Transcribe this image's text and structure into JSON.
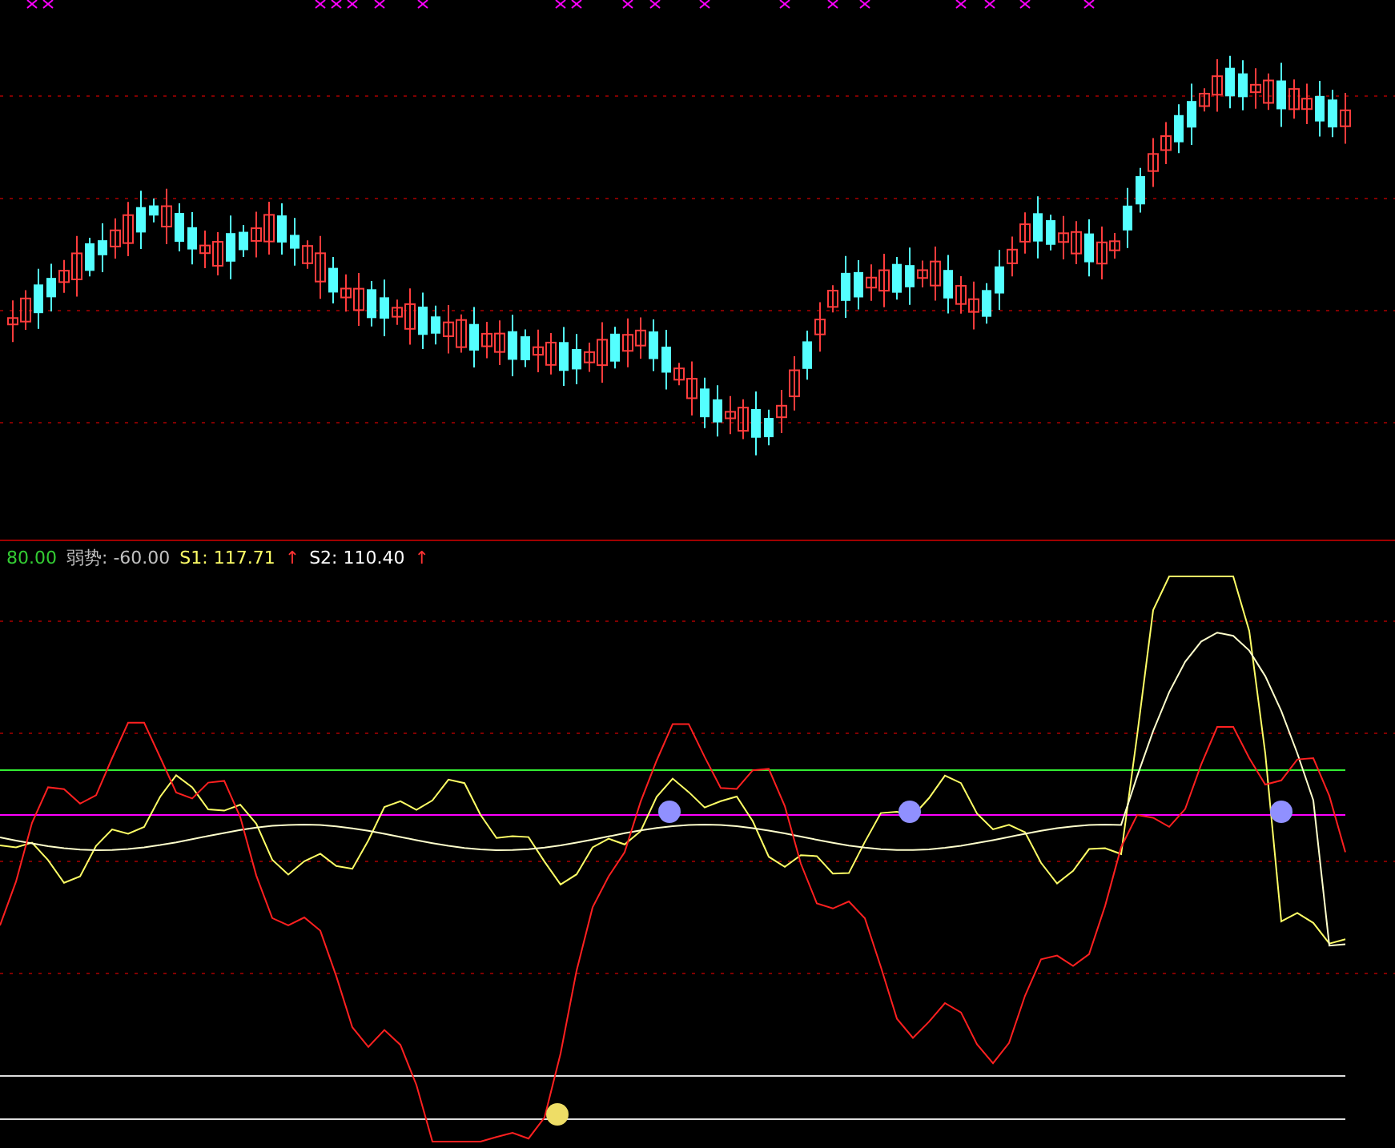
{
  "indicator_legend": [
    {
      "text": "80.00",
      "color": "#33cc33"
    },
    {
      "text": "弱势: -60.00",
      "color": "#c0c0c0"
    },
    {
      "text": "S1: 117.71",
      "color": "#ffff66"
    },
    {
      "text": "↑",
      "color": "#ff3333"
    },
    {
      "text": "S2: 110.40",
      "color": "#ffffff"
    },
    {
      "text": "↑",
      "color": "#ff3333"
    }
  ]
}
